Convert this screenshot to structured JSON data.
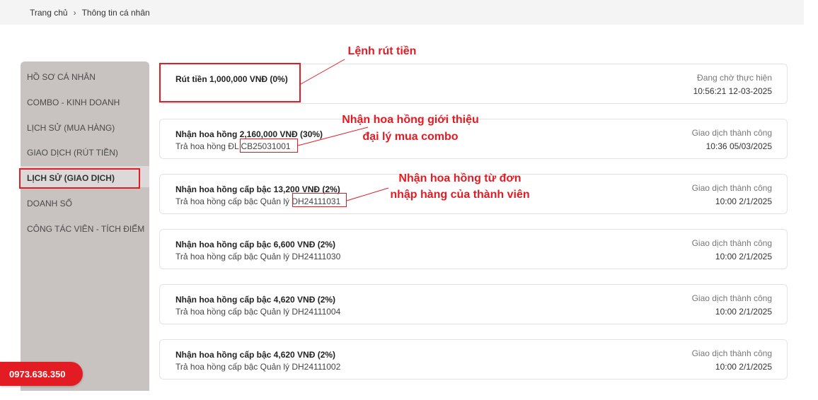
{
  "breadcrumb": {
    "home": "Trang chủ",
    "separator": "›",
    "current": "Thông tin cá nhân"
  },
  "sidebar": {
    "items": [
      {
        "label": "HỒ SƠ CÁ NHÂN"
      },
      {
        "label": "COMBO - KINH DOANH"
      },
      {
        "label": "LỊCH SỬ (MUA HÀNG)"
      },
      {
        "label": "GIAO DỊCH (RÚT TIỀN)"
      },
      {
        "label": "LỊCH SỬ (GIAO DỊCH)",
        "active": true
      },
      {
        "label": "DOANH SỐ"
      },
      {
        "label": "CÔNG TÁC VIÊN - TÍCH ĐIỂM"
      }
    ]
  },
  "transactions": [
    {
      "title": "Rút tiền 1,000,000 VNĐ (0%)",
      "desc": "",
      "status": "Đang chờ thực hiện",
      "time": "10:56:21 12-03-2025"
    },
    {
      "title": "Nhận hoa hồng 2,160,000 VNĐ (30%)",
      "desc_prefix": "Trả hoa hồng ĐL ",
      "code": "CB25031001",
      "status": "Giao dịch thành công",
      "time": "10:36 05/03/2025"
    },
    {
      "title": "Nhận hoa hồng cấp bậc 13,200 VNĐ (2%)",
      "desc_prefix": "Trả hoa hồng cấp bậc Quản lý ",
      "code": "DH24111031",
      "status": "Giao dịch thành công",
      "time": "10:00 2/1/2025"
    },
    {
      "title": "Nhận hoa hồng cấp bậc 6,600 VNĐ (2%)",
      "desc_prefix": "Trả hoa hồng cấp bậc Quản lý ",
      "code": "DH24111030",
      "status": "Giao dịch thành công",
      "time": "10:00 2/1/2025"
    },
    {
      "title": "Nhận hoa hồng cấp bậc 4,620 VNĐ (2%)",
      "desc_prefix": "Trả hoa hồng cấp bậc Quản lý ",
      "code": "DH24111004",
      "status": "Giao dịch thành công",
      "time": "10:00 2/1/2025"
    },
    {
      "title": "Nhận hoa hồng cấp bậc 4,620 VNĐ (2%)",
      "desc_prefix": "Trả hoa hồng cấp bậc Quản lý ",
      "code": "DH24111002",
      "status": "Giao dịch thành công",
      "time": "10:00 2/1/2025"
    }
  ],
  "annotations": {
    "withdraw": "Lệnh rút tiền",
    "referral_line1": "Nhận hoa hồng giới thiệu",
    "referral_line2": "đại lý mua combo",
    "member_line1": "Nhận hoa hồng từ đơn",
    "member_line2": "nhập hàng của thành viên"
  },
  "phone": "0973.636.350",
  "colors": {
    "accent": "#e31b23",
    "sidebar_bg": "#c8c3c1"
  }
}
